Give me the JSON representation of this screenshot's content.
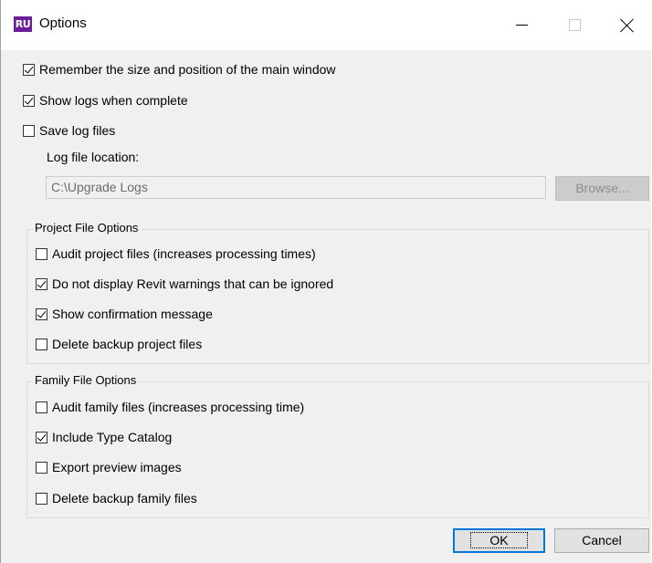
{
  "window": {
    "icon_text": "RU",
    "title": "Options"
  },
  "general": {
    "remember_size": {
      "label": "Remember the size and position of the main window",
      "checked": true
    },
    "show_logs": {
      "label": "Show logs when complete",
      "checked": true
    },
    "save_logs": {
      "label": "Save log files",
      "checked": false
    },
    "log_location_label": "Log file location:",
    "log_location_value": "C:\\Upgrade Logs",
    "browse_label": "Browse..."
  },
  "project_options": {
    "title": "Project File Options",
    "items": [
      {
        "label": "Audit project files (increases processing times)",
        "checked": false
      },
      {
        "label": "Do not display Revit warnings that can be ignored",
        "checked": true
      },
      {
        "label": "Show confirmation message",
        "checked": true
      },
      {
        "label": "Delete backup project files",
        "checked": false
      }
    ]
  },
  "family_options": {
    "title": "Family File Options",
    "items": [
      {
        "label": "Audit family files (increases processing time)",
        "checked": false
      },
      {
        "label": "Include Type Catalog",
        "checked": true
      },
      {
        "label": "Export preview images",
        "checked": false
      },
      {
        "label": "Delete backup family files",
        "checked": false
      }
    ]
  },
  "buttons": {
    "ok": "OK",
    "cancel": "Cancel"
  }
}
